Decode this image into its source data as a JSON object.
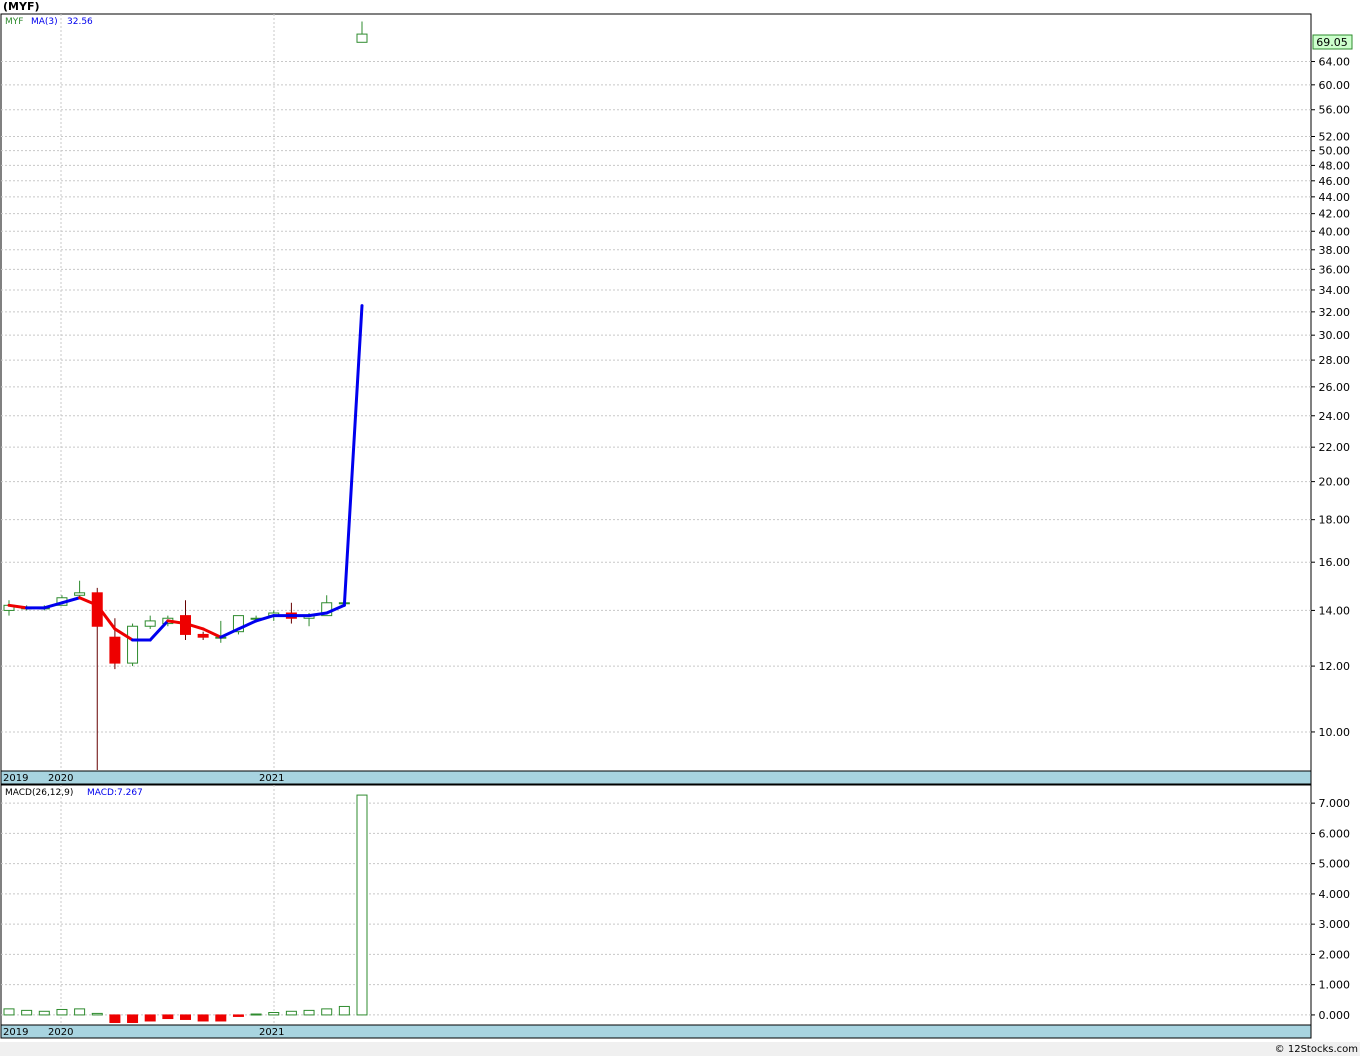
{
  "header": {
    "title": "(MYF)",
    "symbol_label": "MYF",
    "ma_label": "MA(3)",
    "ma_value": "32.56",
    "macd_label": "MACD(26,12,9)",
    "macd_value_label": "MACD:7.267",
    "last_price": "69.05",
    "copyright": "© 12Stocks.com"
  },
  "colors": {
    "up_candle": "#2e8b2e",
    "down_candle": "#ee0000",
    "ma_up": "#0000ee",
    "ma_down": "#ee0000",
    "last_price_bg": "#ccffcc",
    "time_strip": "#a8d4e0",
    "grid": "#c8c8c8",
    "label_green": "#2e8b2e",
    "label_blue": "#0000ee"
  },
  "chart_data": [
    {
      "type": "candlestick",
      "name": "price",
      "y_scale": "log",
      "ylim": [
        9.0,
        73.0
      ],
      "price_ticks": [
        "10.00",
        "12.00",
        "14.00",
        "16.00",
        "18.00",
        "20.00",
        "22.00",
        "24.00",
        "26.00",
        "28.00",
        "30.00",
        "32.00",
        "34.00",
        "36.00",
        "38.00",
        "40.00",
        "42.00",
        "44.00",
        "46.00",
        "48.00",
        "50.00",
        "52.00",
        "56.00",
        "60.00",
        "64.00"
      ],
      "x_labels": [
        "2019",
        "2020",
        "2021"
      ],
      "candles": [
        {
          "o": 14.0,
          "h": 14.4,
          "l": 13.8,
          "c": 14.2
        },
        {
          "o": 14.1,
          "h": 14.2,
          "l": 14.0,
          "c": 14.1
        },
        {
          "o": 14.1,
          "h": 14.2,
          "l": 14.0,
          "c": 14.1
        },
        {
          "o": 14.2,
          "h": 14.6,
          "l": 14.2,
          "c": 14.5
        },
        {
          "o": 14.6,
          "h": 15.2,
          "l": 14.5,
          "c": 14.7
        },
        {
          "o": 14.7,
          "h": 14.9,
          "l": 9.0,
          "c": 13.4
        },
        {
          "o": 13.0,
          "h": 13.7,
          "l": 11.9,
          "c": 12.1
        },
        {
          "o": 12.1,
          "h": 13.5,
          "l": 12.0,
          "c": 13.4
        },
        {
          "o": 13.4,
          "h": 13.8,
          "l": 13.3,
          "c": 13.6
        },
        {
          "o": 13.5,
          "h": 13.8,
          "l": 13.4,
          "c": 13.7
        },
        {
          "o": 13.8,
          "h": 14.4,
          "l": 12.9,
          "c": 13.1
        },
        {
          "o": 13.1,
          "h": 13.2,
          "l": 12.9,
          "c": 13.0
        },
        {
          "o": 13.0,
          "h": 13.6,
          "l": 12.8,
          "c": 13.0
        },
        {
          "o": 13.2,
          "h": 13.8,
          "l": 13.1,
          "c": 13.8
        },
        {
          "o": 13.7,
          "h": 13.8,
          "l": 13.6,
          "c": 13.7
        },
        {
          "o": 13.8,
          "h": 14.0,
          "l": 13.6,
          "c": 13.9
        },
        {
          "o": 13.9,
          "h": 14.3,
          "l": 13.5,
          "c": 13.7
        },
        {
          "o": 13.7,
          "h": 13.9,
          "l": 13.4,
          "c": 13.8
        },
        {
          "o": 13.8,
          "h": 14.6,
          "l": 13.8,
          "c": 14.3
        },
        {
          "o": 14.3,
          "h": 14.4,
          "l": 14.2,
          "c": 14.3
        },
        {
          "o": 67.5,
          "h": 71.5,
          "l": 67.5,
          "c": 69.05
        }
      ],
      "ma3": [
        14.2,
        14.1,
        14.1,
        14.3,
        14.5,
        14.2,
        13.3,
        12.9,
        12.9,
        13.6,
        13.5,
        13.3,
        13.0,
        13.3,
        13.6,
        13.8,
        13.8,
        13.8,
        13.9,
        14.2,
        32.56
      ]
    },
    {
      "type": "bar",
      "name": "macd",
      "ylim": [
        -0.3,
        7.6
      ],
      "ticks": [
        "0.000",
        "1.000",
        "2.000",
        "3.000",
        "4.000",
        "5.000",
        "6.000",
        "7.000"
      ],
      "x_labels": [
        "2019",
        "2020",
        "2021"
      ],
      "values": [
        0.2,
        0.15,
        0.12,
        0.18,
        0.2,
        0.05,
        -0.25,
        -0.25,
        -0.2,
        -0.12,
        -0.15,
        -0.2,
        -0.2,
        -0.05,
        0.03,
        0.08,
        0.12,
        0.15,
        0.2,
        0.28,
        7.267
      ]
    }
  ]
}
